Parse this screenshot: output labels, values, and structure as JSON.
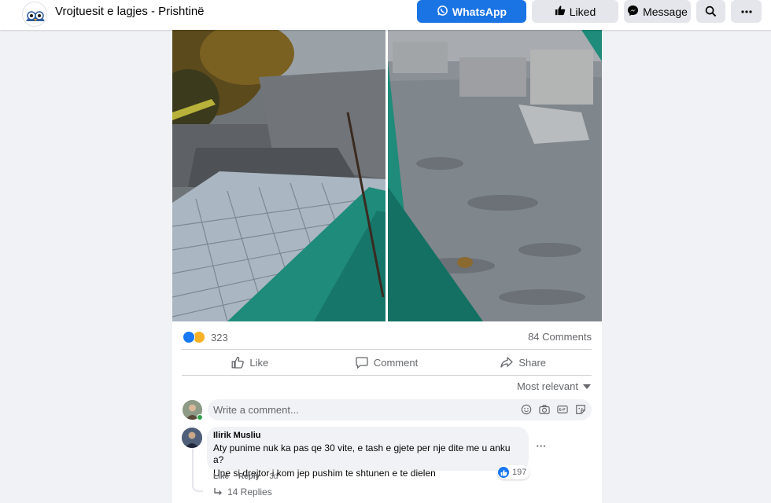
{
  "page": {
    "name": "Vrojtuesit e lagjes - Prishtinë",
    "avatar_icon": "owl-logo-icon"
  },
  "header_buttons": {
    "whatsapp": "WhatsApp",
    "liked": "Liked",
    "message": "Message",
    "search_icon": "search-icon",
    "more_icon": "more-icon"
  },
  "colors": {
    "primary": "#1b74e4",
    "secondary_button": "#e4e6eb",
    "muted_text": "#65676b",
    "page_bg": "#f0f2f5"
  },
  "post": {
    "reaction_count": "323",
    "reaction_types": [
      "like",
      "haha"
    ],
    "comments_count": "84 Comments",
    "actions": {
      "like": "Like",
      "comment": "Comment",
      "share": "Share"
    },
    "sort_label": "Most relevant"
  },
  "comment_input": {
    "placeholder": "Write a comment...",
    "icons": [
      "emoji-icon",
      "camera-icon",
      "gif-icon",
      "sticker-icon"
    ]
  },
  "comments": [
    {
      "author": "Ilirik Musliu",
      "line1": "Aty punime nuk ka pas qe 30 vite, e tash e gjete per nje dite me u anku a?",
      "line2": "Une si drejtor i kom jep pushim te shtunen e te dielen",
      "like_count": "197",
      "like_action": "Like",
      "reply_action": "Reply",
      "time": "3d",
      "replies": "14 Replies"
    }
  ]
}
